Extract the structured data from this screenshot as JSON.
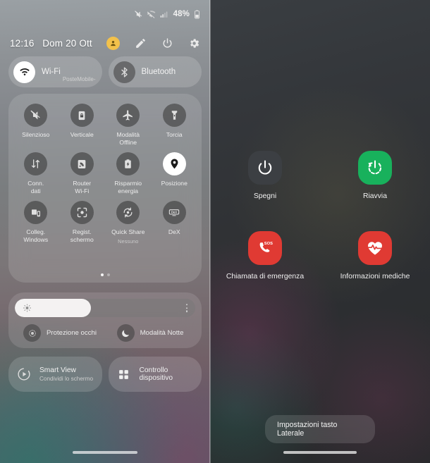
{
  "status_bar": {
    "icons": [
      "mute-icon",
      "wifi-off-icon",
      "signal-icon"
    ],
    "battery_percent": "48%",
    "battery_icon": "battery-icon"
  },
  "quick_settings": {
    "clock": "12:16",
    "date": "Dom 20 Ott",
    "header_actions": [
      {
        "name": "profile-avatar",
        "icon": "user-icon"
      },
      {
        "name": "edit-button",
        "icon": "pencil-icon"
      },
      {
        "name": "power-button",
        "icon": "power-icon"
      },
      {
        "name": "settings-button",
        "icon": "gear-icon"
      }
    ],
    "connectivity": [
      {
        "label": "Wi-Fi",
        "sublabel": "PosteMobile-",
        "icon": "wifi-icon",
        "state": "on"
      },
      {
        "label": "Bluetooth",
        "sublabel": "",
        "icon": "bluetooth-icon",
        "state": "off"
      }
    ],
    "tiles": [
      {
        "label": "Silenzioso",
        "sublabel": "",
        "icon": "mute-icon",
        "state": "off"
      },
      {
        "label": "Verticale",
        "sublabel": "",
        "icon": "rotation-lock-icon",
        "state": "off"
      },
      {
        "label": "Modalità\nOffline",
        "sublabel": "",
        "icon": "airplane-icon",
        "state": "off"
      },
      {
        "label": "Torcia",
        "sublabel": "",
        "icon": "flashlight-icon",
        "state": "off"
      },
      {
        "label": "Conn.\ndati",
        "sublabel": "",
        "icon": "mobile-data-icon",
        "state": "off"
      },
      {
        "label": "Router\nWi-Fi",
        "sublabel": "",
        "icon": "hotspot-icon",
        "state": "off"
      },
      {
        "label": "Risparmio\nenergia",
        "sublabel": "",
        "icon": "battery-saver-icon",
        "state": "off"
      },
      {
        "label": "Posizione",
        "sublabel": "",
        "icon": "location-pin-icon",
        "state": "on"
      },
      {
        "label": "Colleg.\nWindows",
        "sublabel": "",
        "icon": "link-to-windows-icon",
        "state": "off"
      },
      {
        "label": "Regist.\nschermo",
        "sublabel": "",
        "icon": "screen-recorder-icon",
        "state": "off"
      },
      {
        "label": "Quick Share",
        "sublabel": "Nessuno",
        "icon": "quick-share-icon",
        "state": "off"
      },
      {
        "label": "DeX",
        "sublabel": "",
        "icon": "dex-icon",
        "state": "off"
      }
    ],
    "page_dots": {
      "count": 2,
      "active_index": 0
    },
    "brightness": {
      "value_percent": 42,
      "icon": "brightness-icon",
      "menu_icon": "more-options-icon"
    },
    "brightness_actions": [
      {
        "label": "Protezione occhi",
        "icon": "eye-comfort-icon"
      },
      {
        "label": "Modalità Notte",
        "icon": "moon-icon"
      }
    ],
    "bottom_tiles": [
      {
        "title": "Smart View",
        "subtitle": "Condividi lo schermo",
        "icon": "smart-view-icon"
      },
      {
        "title": "Controllo dispositivo",
        "subtitle": "",
        "icon": "device-control-icon"
      }
    ]
  },
  "power_menu": {
    "options": [
      {
        "label": "Spegni",
        "icon": "power-icon",
        "color": "#3c3f43"
      },
      {
        "label": "Riavvia",
        "icon": "restart-icon",
        "color": "#18b15c"
      },
      {
        "label": "Chiamata di emergenza",
        "icon": "sos-call-icon",
        "color": "#e03a33"
      },
      {
        "label": "Informazioni mediche",
        "icon": "medical-heart-icon",
        "color": "#e03a33"
      }
    ],
    "side_key_settings": "Impostazioni tasto Laterale"
  }
}
